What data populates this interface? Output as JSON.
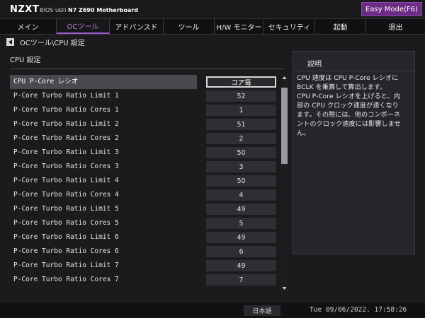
{
  "header": {
    "logo": "NZXT",
    "bios": "BIOS",
    "uefi": "UEFI",
    "model": "N7 Z690 Motherboard",
    "easy_mode_label": "Easy Mode(F6)"
  },
  "nav": {
    "tabs": [
      {
        "label": "メイン",
        "active": false
      },
      {
        "label": "OCツール",
        "active": true
      },
      {
        "label": "アドバンスド",
        "active": false
      },
      {
        "label": "ツール",
        "active": false
      },
      {
        "label": "H/W モニター",
        "active": false
      },
      {
        "label": "セキュリティ",
        "active": false
      },
      {
        "label": "起動",
        "active": false
      },
      {
        "label": "退出",
        "active": false
      }
    ]
  },
  "breadcrumb": "OCツール\\CPU 設定",
  "section_title": "CPU 設定",
  "settings": {
    "rows": [
      {
        "label": "CPU P-Core レシオ",
        "value": "コア毎"
      },
      {
        "label": "P-Core Turbo Ratio Limit 1",
        "value": "52"
      },
      {
        "label": "P-Core Turbo Ratio Cores 1",
        "value": "1"
      },
      {
        "label": "P-Core Turbo Ratio Limit 2",
        "value": "51"
      },
      {
        "label": "P-Core Turbo Ratio Cores 2",
        "value": "2"
      },
      {
        "label": "P-Core Turbo Ratio Limit 3",
        "value": "50"
      },
      {
        "label": "P-Core Turbo Ratio Cores 3",
        "value": "3"
      },
      {
        "label": "P-Core Turbo Ratio Limit 4",
        "value": "50"
      },
      {
        "label": "P-Core Turbo Ratio Cores 4",
        "value": "4"
      },
      {
        "label": "P-Core Turbo Ratio Limit 5",
        "value": "49"
      },
      {
        "label": "P-Core Turbo Ratio Cores 5",
        "value": "5"
      },
      {
        "label": "P-Core Turbo Ratio Limit 6",
        "value": "49"
      },
      {
        "label": "P-Core Turbo Ratio Cores 6",
        "value": "6"
      },
      {
        "label": "P-Core Turbo Ratio Limit 7",
        "value": "49"
      },
      {
        "label": "P-Core Turbo Ratio Cores 7",
        "value": "7"
      }
    ]
  },
  "help": {
    "title": "説明",
    "lines": [
      "CPU 速度は CPU P-Core レシオに",
      "BCLK を乗算して算出します。",
      "CPU P-Core レシオを上げると、内",
      "部の CPU クロック速度が速くなり",
      "ます。その際には、他のコンポーネ",
      "ントのクロック速度には影響しませ",
      "ん。"
    ]
  },
  "footer": {
    "language": "日本語",
    "datetime": "Tue 09/06/2022. 17:58:26"
  },
  "colors": {
    "accent": "#a25bd6",
    "easy_mode_bg": "#6b2c83",
    "background": "#1b1b1e"
  }
}
